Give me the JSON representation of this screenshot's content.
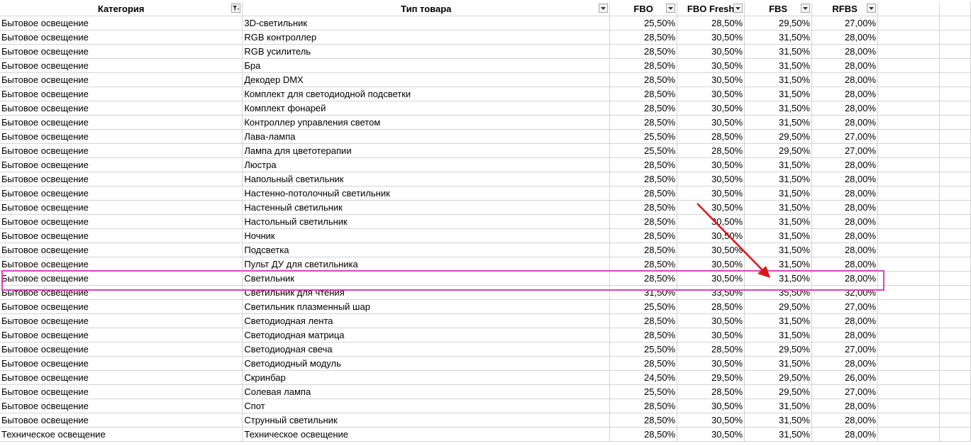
{
  "headers": {
    "category": "Категория",
    "type": "Тип товара",
    "fbo": "FBO",
    "fbo_fresh": "FBO Fresh",
    "fbs": "FBS",
    "rfbs": "RFBS"
  },
  "rows": [
    [
      "Бытовое освещение",
      "3D-светильник",
      "25,50%",
      "28,50%",
      "29,50%",
      "27,00%"
    ],
    [
      "Бытовое освещение",
      "RGB контроллер",
      "28,50%",
      "30,50%",
      "31,50%",
      "28,00%"
    ],
    [
      "Бытовое освещение",
      "RGB усилитель",
      "28,50%",
      "30,50%",
      "31,50%",
      "28,00%"
    ],
    [
      "Бытовое освещение",
      "Бра",
      "28,50%",
      "30,50%",
      "31,50%",
      "28,00%"
    ],
    [
      "Бытовое освещение",
      "Декодер DMX",
      "28,50%",
      "30,50%",
      "31,50%",
      "28,00%"
    ],
    [
      "Бытовое освещение",
      "Комплект для светодиодной подсветки",
      "28,50%",
      "30,50%",
      "31,50%",
      "28,00%"
    ],
    [
      "Бытовое освещение",
      "Комплект фонарей",
      "28,50%",
      "30,50%",
      "31,50%",
      "28,00%"
    ],
    [
      "Бытовое освещение",
      "Контроллер управления светом",
      "28,50%",
      "30,50%",
      "31,50%",
      "28,00%"
    ],
    [
      "Бытовое освещение",
      "Лава-лампа",
      "25,50%",
      "28,50%",
      "29,50%",
      "27,00%"
    ],
    [
      "Бытовое освещение",
      "Лампа для цветотерапии",
      "25,50%",
      "28,50%",
      "29,50%",
      "27,00%"
    ],
    [
      "Бытовое освещение",
      "Люстра",
      "28,50%",
      "30,50%",
      "31,50%",
      "28,00%"
    ],
    [
      "Бытовое освещение",
      "Напольный светильник",
      "28,50%",
      "30,50%",
      "31,50%",
      "28,00%"
    ],
    [
      "Бытовое освещение",
      "Настенно-потолочный светильник",
      "28,50%",
      "30,50%",
      "31,50%",
      "28,00%"
    ],
    [
      "Бытовое освещение",
      "Настенный светильник",
      "28,50%",
      "30,50%",
      "31,50%",
      "28,00%"
    ],
    [
      "Бытовое освещение",
      "Настольный светильник",
      "28,50%",
      "30,50%",
      "31,50%",
      "28,00%"
    ],
    [
      "Бытовое освещение",
      "Ночник",
      "28,50%",
      "30,50%",
      "31,50%",
      "28,00%"
    ],
    [
      "Бытовое освещение",
      "Подсветка",
      "28,50%",
      "30,50%",
      "31,50%",
      "28,00%"
    ],
    [
      "Бытовое освещение",
      "Пульт ДУ для светильника",
      "28,50%",
      "30,50%",
      "31,50%",
      "28,00%"
    ],
    [
      "Бытовое освещение",
      "Светильник",
      "28,50%",
      "30,50%",
      "31,50%",
      "28,00%"
    ],
    [
      "Бытовое освещение",
      "Светильник для чтения",
      "31,50%",
      "33,50%",
      "35,50%",
      "32,00%"
    ],
    [
      "Бытовое освещение",
      "Светильник плазменный шар",
      "25,50%",
      "28,50%",
      "29,50%",
      "27,00%"
    ],
    [
      "Бытовое освещение",
      "Светодиодная лента",
      "28,50%",
      "30,50%",
      "31,50%",
      "28,00%"
    ],
    [
      "Бытовое освещение",
      "Светодиодная матрица",
      "28,50%",
      "30,50%",
      "31,50%",
      "28,00%"
    ],
    [
      "Бытовое освещение",
      "Светодиодная свеча",
      "25,50%",
      "28,50%",
      "29,50%",
      "27,00%"
    ],
    [
      "Бытовое освещение",
      "Светодиодный модуль",
      "28,50%",
      "30,50%",
      "31,50%",
      "28,00%"
    ],
    [
      "Бытовое освещение",
      "Скринбар",
      "24,50%",
      "29,50%",
      "29,50%",
      "26,00%"
    ],
    [
      "Бытовое освещение",
      "Солевая лампа",
      "25,50%",
      "28,50%",
      "29,50%",
      "27,00%"
    ],
    [
      "Бытовое освещение",
      "Спот",
      "28,50%",
      "30,50%",
      "31,50%",
      "28,00%"
    ],
    [
      "Бытовое освещение",
      "Струнный светильник",
      "28,50%",
      "30,50%",
      "31,50%",
      "28,00%"
    ],
    [
      "Техническое освещение",
      "Техническое освещение",
      "28,50%",
      "30,50%",
      "31,50%",
      "28,00%"
    ]
  ],
  "annotation": {
    "highlight_color": "#e040c0",
    "arrow_color": "#d9161a",
    "highlighted_row": 18
  },
  "icons": {
    "filter_active": "filter-funnel-icon",
    "filter_dropdown": "chevron-down-icon"
  }
}
